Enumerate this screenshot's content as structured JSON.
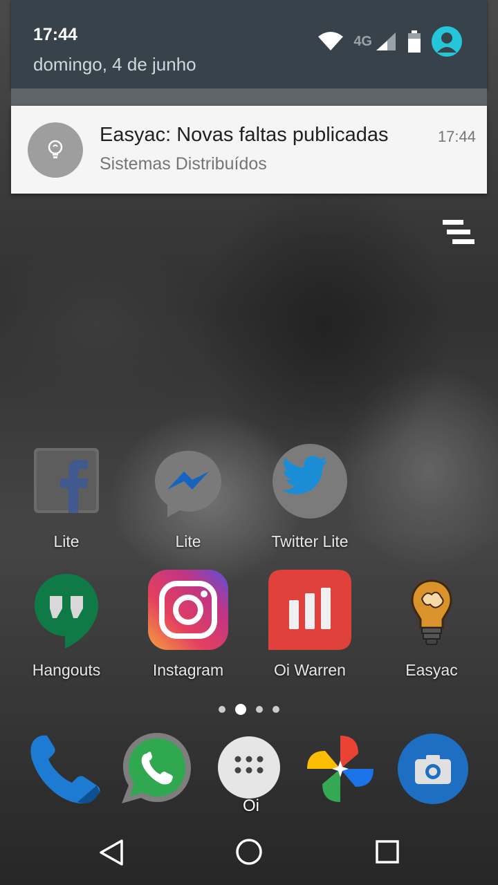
{
  "status": {
    "time": "17:44",
    "date": "domingo, 4 de junho",
    "network_label": "4G"
  },
  "notification": {
    "title": "Easyac: Novas faltas publicadas",
    "time": "17:44",
    "text": "Sistemas Distribuídos",
    "icon": "lightbulb-icon"
  },
  "apps_row1": [
    {
      "label": "Lite",
      "icon": "facebook-lite-icon"
    },
    {
      "label": "Lite",
      "icon": "messenger-lite-icon"
    },
    {
      "label": "Twitter Lite",
      "icon": "twitter-lite-icon"
    }
  ],
  "apps_row2": [
    {
      "label": "Hangouts",
      "icon": "hangouts-icon"
    },
    {
      "label": "Instagram",
      "icon": "instagram-icon"
    },
    {
      "label": "Oi Warren",
      "icon": "oi-warren-icon"
    },
    {
      "label": "Easyac",
      "icon": "easyac-icon"
    }
  ],
  "dock": {
    "app_drawer_label": "Oi",
    "items": [
      "phone-icon",
      "whatsapp-icon",
      "app-drawer-icon",
      "google-photos-icon",
      "camera-icon"
    ]
  },
  "page_indicator": {
    "count": 4,
    "active": 1
  },
  "colors": {
    "shade_bg": "#37424b",
    "avatar": "#26c6da",
    "facebook": "#3b5998",
    "messenger": "#0084ff",
    "twitter": "#1da1f2",
    "hangouts": "#0f9d58",
    "oi_warren": "#e8453c",
    "camera": "#1e88e5"
  }
}
